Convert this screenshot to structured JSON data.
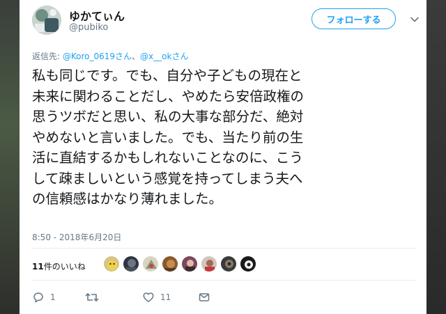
{
  "user": {
    "display_name": "ゆかてぃん",
    "handle": "@pubiko"
  },
  "follow_button": "フォローする",
  "reply": {
    "prefix": "返信先: ",
    "mention1": "@Koro_0619さん",
    "separator": "、",
    "mention2": "@x__okさん"
  },
  "tweet": {
    "lines": [
      "私も同じです。でも、自分や子どもの現在と",
      "未来に関わることだし、やめたら安倍政権の",
      "思うツボだと思い、私の大事な部分だ、絶対",
      "やめないと言いました。でも、当たり前の生",
      "活に直結するかもしれないことなのに、こう",
      "して疎ましいという感覚を持ってしまう夫へ",
      "の信頼感はかなり薄れました。"
    ],
    "timestamp": "8:50 - 2018年6月20日"
  },
  "likes": {
    "count": "11",
    "label": "件のいいね"
  },
  "actions": {
    "reply_count": "1",
    "retweet_count": "",
    "like_count": "11"
  },
  "colors": {
    "accent": "#1da1f2",
    "muted": "#657786",
    "text": "#14171a"
  },
  "icons": [
    "reply-icon",
    "retweet-icon",
    "heart-icon",
    "dm-icon",
    "caret-down-icon"
  ]
}
